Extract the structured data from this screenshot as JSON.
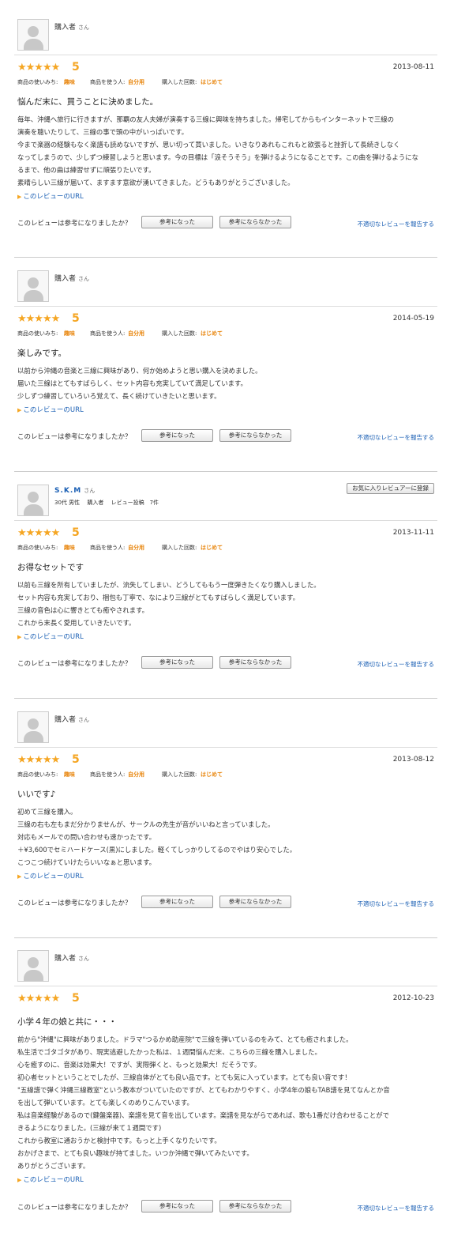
{
  "common": {
    "san": "さん",
    "usage_label": "商品の使いみち:",
    "user_label": "商品を使う人:",
    "times_label": "購入した回数:",
    "link_text": "このレビューのURL",
    "helpful_question": "このレビューは参考になりましたか？",
    "helpful_yes": "参考になった",
    "helpful_no": "参考にならなかった",
    "report": "不適切なレビューを報告する",
    "stars": "★★★★★",
    "accent_color": "#f5a623",
    "link_color": "#1a5fb4"
  },
  "reviews": [
    {
      "reviewer": "購入者",
      "rating": "5",
      "date": "2013-08-11",
      "usage": "趣味",
      "user": "自分用",
      "times": "はじめて",
      "title": "悩んだ末に、買うことに決めました。",
      "body": [
        "毎年、沖縄へ旅行に行きますが、那覇の友人夫婦が演奏する三線に興味を持ちました。帰宅してからもインターネットで三線の",
        "演奏を聴いたりして、三線の事で頭の中がいっぱいです。",
        "今まで楽器の経験もなく楽譜も読めないですが、思い切って買いました。いきなりあれもこれもと欲張ると挫折して長続きしなく",
        "なってしまうので、少しずつ練習しようと思います。今の目標は「涙そうそう」を弾けるようになることです。この曲を弾けるようにな",
        "るまで、他の曲は練習せずに頑張りたいです。",
        "素晴らしい三線が届いて、ますます意欲が湧いてきました。どうもありがとうございました。"
      ]
    },
    {
      "reviewer": "購入者",
      "rating": "5",
      "date": "2014-05-19",
      "usage": "趣味",
      "user": "自分用",
      "times": "はじめて",
      "title": "楽しみです。",
      "body": [
        "以前から沖縄の音楽と三線に興味があり、何か始めようと思い購入を決めました。",
        "届いた三線はとてもすばらしく、セット内容も充実していて満足しています。",
        "少しずつ練習していろいろ覚えて、長く続けていきたいと思います。"
      ]
    },
    {
      "reviewer": "S.K.M",
      "reviewer_meta": "30代 男性　 購入者　 レビュー投稿　7件",
      "fav_button": "お気に入りレビュアーに登録",
      "rating": "5",
      "date": "2013-11-11",
      "usage": "趣味",
      "user": "自分用",
      "times": "はじめて",
      "title": "お得なセットです",
      "body": [
        "以前も三線を所有していましたが、流失してしまい、どうしてももう一度弾きたくなり購入しました。",
        "セット内容も充実しており、梱包も丁寧で、なにより三線がとてもすばらしく満足しています。",
        "三線の音色は心に響きとても癒やされます。",
        "これから末長く愛用していきたいです。"
      ]
    },
    {
      "reviewer": "購入者",
      "rating": "5",
      "date": "2013-08-12",
      "usage": "趣味",
      "user": "自分用",
      "times": "はじめて",
      "title": "いいです♪",
      "body": [
        "初めて三線を購入。",
        "三線の右も左もまだ分かりませんが、サークルの先生が音がいいねと言っていました。",
        "対応もメールでの問い合わせも速かったです。",
        "＋¥3,600でセミハードケース(黒)にしました。軽くてしっかりしてるのでやはり安心でした。",
        "こつこつ続けていけたらいいなぁと思います。"
      ]
    },
    {
      "reviewer": "購入者",
      "rating": "5",
      "date": "2012-10-23",
      "title": "小学４年の娘と共に・・・",
      "body": [
        "前から\"沖縄\"に興味がありました。ドラマ\"つるかめ助産院\"で三線を弾いているのをみて、とても癒されました。",
        "私生活でゴタゴタがあり、現実逃避したかった私は、１週間悩んだ末、こちらの三線を購入しました。",
        "心を癒すのに、音楽は効果大！ですが、実際弾くと、もっと効果大！だそうです。",
        "初心者セットということでしたが、三線自体がとても良い品です。とても気に入っています。とても良い音です！",
        "\"五線譜で弾く沖縄三線教室\"という教本がついていたのですが、とてもわかりやすく、小学4年の娘もTAB譜を見てなんとか音",
        "を出して弾いています。とても楽しくのめりこんでいます。",
        "私は音楽経験があるので(鍵盤楽器)、楽譜を見て音を出しています。楽譜を見ながらであれば、歌も1番だけ合わせることがで",
        "きるようになりました。(三線が来て１週間です)",
        "これから教室に通おうかと検討中です。もっと上手くなりたいです。",
        "おかげさまで、とても良い趣味が持てました。いつか沖縄で弾いてみたいです。",
        "ありがとうございます。"
      ]
    }
  ]
}
